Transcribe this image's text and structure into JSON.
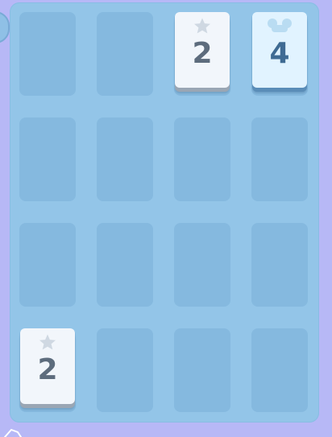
{
  "board": {
    "rows": 4,
    "cols": 4,
    "tiles": [
      {
        "row": 0,
        "col": 2,
        "value": "2",
        "icon": "star-icon",
        "style": "two"
      },
      {
        "row": 0,
        "col": 3,
        "value": "4",
        "icon": "mouse-ears-icon",
        "style": "four"
      },
      {
        "row": 3,
        "col": 0,
        "value": "2",
        "icon": "star-icon",
        "style": "two"
      }
    ]
  },
  "colors": {
    "background": "#b7b8f6",
    "board": "#93c5e8",
    "empty_cell": "#85b9df",
    "tile_two": "#f2f6fb",
    "tile_two_text": "#5d6c7d",
    "tile_four": "#e1f3ff",
    "tile_four_text": "#3f6b93"
  }
}
